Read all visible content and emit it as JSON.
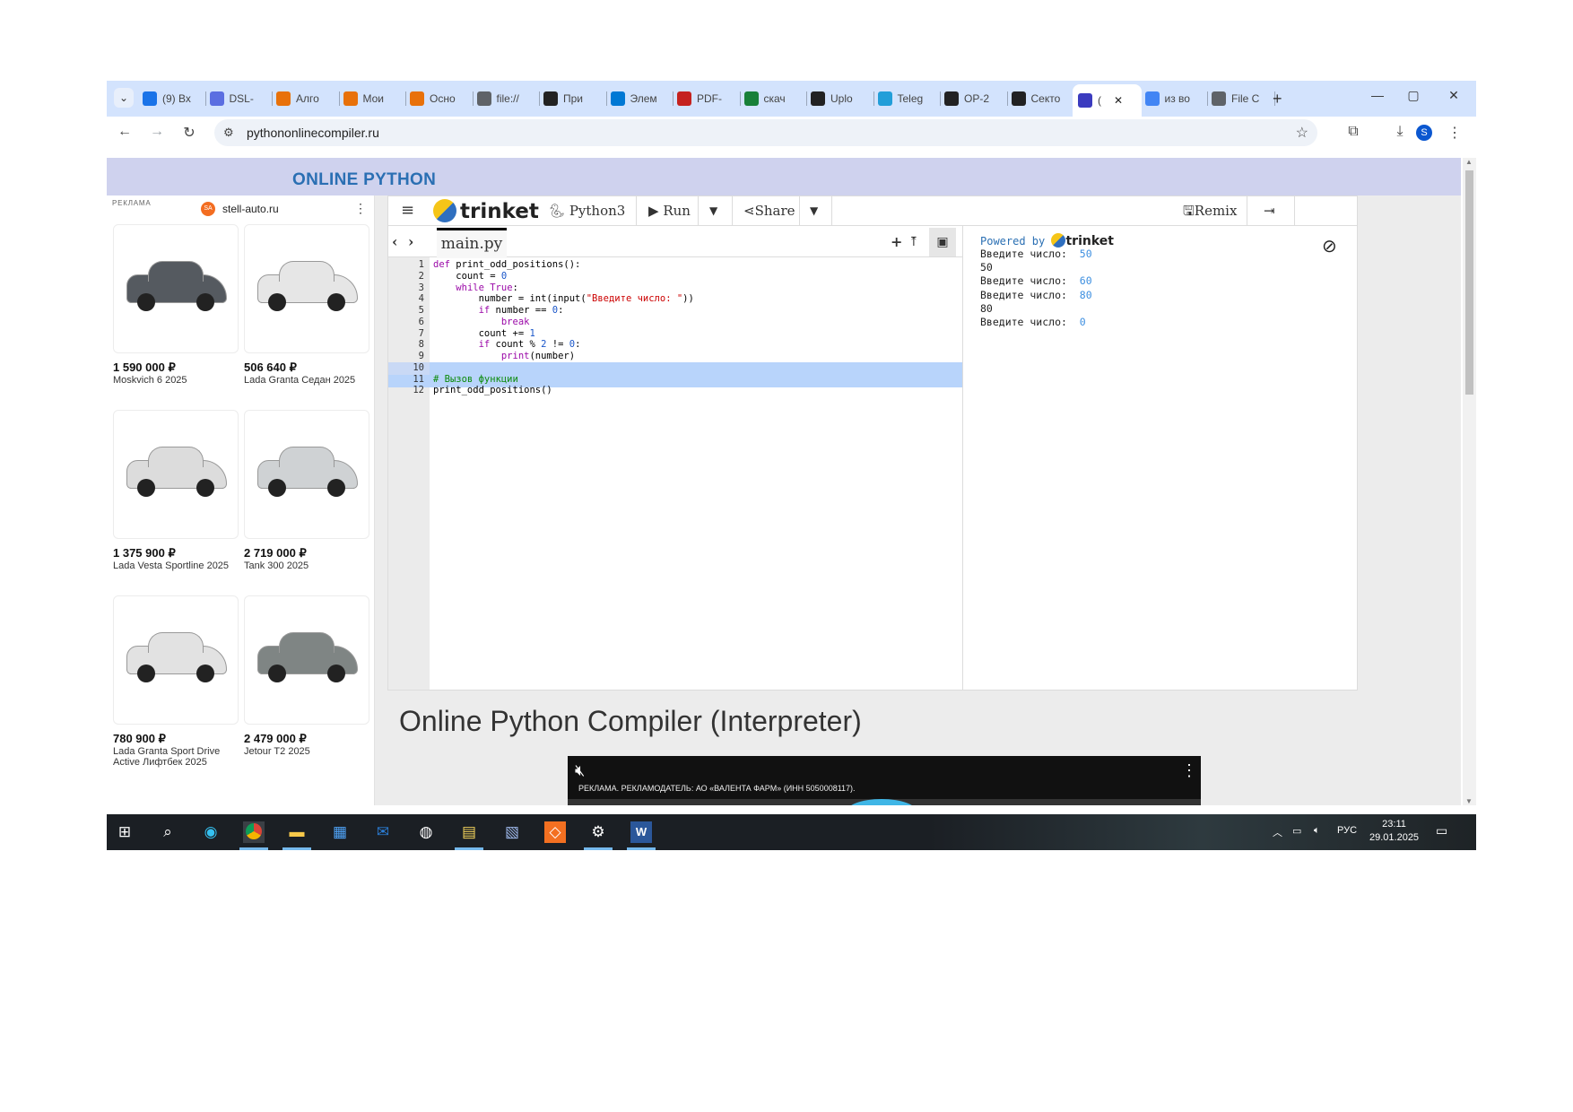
{
  "browser": {
    "tabs": [
      {
        "label": "(9) Вх",
        "icon": "mail-icon",
        "color": "#1a73e8"
      },
      {
        "label": "DSL-",
        "icon": "dsl-icon",
        "color": "#5b6ee1"
      },
      {
        "label": "Алго",
        "icon": "m-icon",
        "color": "#e8710a"
      },
      {
        "label": "Мои",
        "icon": "m-icon",
        "color": "#e8710a"
      },
      {
        "label": "Осно",
        "icon": "m-icon",
        "color": "#e8710a"
      },
      {
        "label": "file://",
        "icon": "globe-icon",
        "color": "#5f6368"
      },
      {
        "label": "При",
        "icon": "github-icon",
        "color": "#222"
      },
      {
        "label": "Элем",
        "icon": "cloud-icon",
        "color": "#0078d4"
      },
      {
        "label": "PDF-",
        "icon": "pdf-icon",
        "color": "#c5221f"
      },
      {
        "label": "скач",
        "icon": "download-icon",
        "color": "#188038"
      },
      {
        "label": "Uplo",
        "icon": "github-icon",
        "color": "#222"
      },
      {
        "label": "Teleg",
        "icon": "telegram-icon",
        "color": "#229ed9"
      },
      {
        "label": "OP-2",
        "icon": "github-icon",
        "color": "#222"
      },
      {
        "label": "Секто",
        "icon": "yandex-icon",
        "color": "#222"
      },
      {
        "label": "(",
        "icon": "trinket-icon",
        "color": "#3b3bbf"
      },
      {
        "label": "из во",
        "icon": "google-icon",
        "color": "#4285f4"
      },
      {
        "label": "File C",
        "icon": "globe-icon",
        "color": "#5f6368"
      }
    ],
    "new_tab": "+",
    "url": "pythononlinecompiler.ru",
    "profile_initial": "S"
  },
  "site": {
    "title": "ONLINE PYTHON",
    "heading": "Online Python Compiler (Interpreter)"
  },
  "ad": {
    "label": "РЕКЛАМА",
    "domain": "stell-auto.ru",
    "domain_badge": "SA",
    "cars": [
      {
        "price": "1 590 000 ₽",
        "name": "Moskvich 6 2025",
        "color": "#555a60"
      },
      {
        "price": "506 640 ₽",
        "name": "Lada Granta Седан 2025",
        "color": "#e6e6e6"
      },
      {
        "price": "1 375 900 ₽",
        "name": "Lada Vesta Sportline 2025",
        "color": "#dcdcdc"
      },
      {
        "price": "2 719 000 ₽",
        "name": "Tank 300 2025",
        "color": "#cfd2d4"
      },
      {
        "price": "780 900 ₽",
        "name": "Lada Granta Sport Drive Active Лифтбек 2025",
        "color": "#e2e2e2"
      },
      {
        "price": "2 479 000 ₽",
        "name": "Jetour T2 2025",
        "color": "#7f8584"
      }
    ]
  },
  "trinket": {
    "brand": "trinket",
    "language": "Python3",
    "run": "Run",
    "share": "Share",
    "remix": "Remix",
    "file_tab": "main.py",
    "powered_by": "Powered by",
    "code_lines": [
      "def print_odd_positions():",
      "    count = 0",
      "    while True:",
      "        number = int(input(\"Введите число: \"))",
      "        if number == 0:",
      "            break",
      "        count += 1",
      "        if count % 2 != 0:",
      "            print(number)",
      "",
      "# Вызов функции",
      "print_odd_positions()"
    ],
    "line_numbers": [
      "1",
      "2",
      "3",
      "4",
      "5",
      "6",
      "7",
      "8",
      "9",
      "10",
      "11",
      "12"
    ],
    "output": [
      {
        "prompt": "Введите число:  ",
        "input": "50"
      },
      {
        "prompt": "50",
        "input": ""
      },
      {
        "prompt": "Введите число:  ",
        "input": "60"
      },
      {
        "prompt": "Введите число:  ",
        "input": "80"
      },
      {
        "prompt": "80",
        "input": ""
      },
      {
        "prompt": "Введите число:  ",
        "input": "0"
      }
    ]
  },
  "video_ad": {
    "caption": "РЕКЛАМА. РЕКЛАМОДАТЕЛЬ: АО «ВАЛЕНТА ФАРМ» (ИНН 5050008117)."
  },
  "taskbar": {
    "lang": "РУС",
    "time": "23:11",
    "date": "29.01.2025"
  }
}
